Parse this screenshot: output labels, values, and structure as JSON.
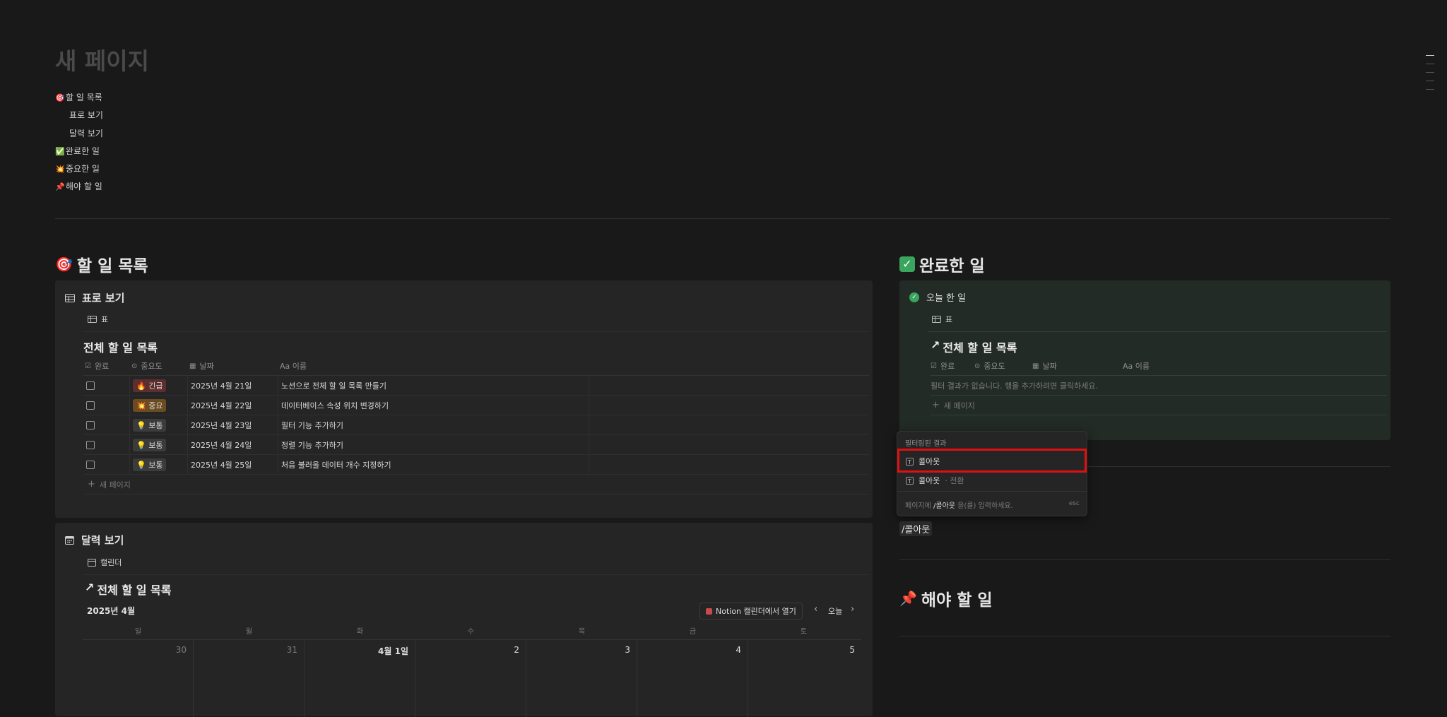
{
  "page": {
    "title": "새 페이지",
    "toc": [
      {
        "emoji": "🎯",
        "label": "할 일 목록"
      },
      {
        "emoji": "",
        "label": "표로 보기"
      },
      {
        "emoji": "",
        "label": "달력 보기"
      },
      {
        "emoji": "✅",
        "label": "완료한 일"
      },
      {
        "emoji": "💥",
        "label": "중요한 일"
      },
      {
        "emoji": "📌",
        "label": "해야 할 일"
      }
    ]
  },
  "todo": {
    "heading_emoji": "🎯",
    "heading": "할 일 목록",
    "table_view": {
      "title": "표로 보기",
      "tab_label": "표",
      "db_title": "전체 할 일 목록",
      "columns": [
        "완료",
        "중요도",
        "날짜",
        "Aa 이름"
      ],
      "rows": [
        {
          "priority": "🔥 긴급",
          "date": "2025년 4월 21일",
          "name": "노션으로 전체 할 일 목록 만들기",
          "tag_color": "#5e2e2e"
        },
        {
          "priority": "💥 중요",
          "date": "2025년 4월 22일",
          "name": "데이터베이스 속성 위치 변경하기",
          "tag_color": "#6b4b22"
        },
        {
          "priority": "💡 보통",
          "date": "2025년 4월 23일",
          "name": "필터 기능 추가하기",
          "tag_color": "#3b3b3b"
        },
        {
          "priority": "💡 보통",
          "date": "2025년 4월 24일",
          "name": "정렬 기능 추가하기",
          "tag_color": "#3b3b3b"
        },
        {
          "priority": "💡 보통",
          "date": "2025년 4월 25일",
          "name": "처음 불러올 데이터 개수 지정하기",
          "tag_color": "#3b3b3b"
        }
      ],
      "new_page": "새 페이지"
    },
    "calendar_view": {
      "title": "달력 보기",
      "tab_label": "캘린더",
      "db_title": "전체 할 일 목록",
      "month": "2025년 4월",
      "open_notion": "Notion 캘린더에서 열기",
      "today": "오늘",
      "weekdays": [
        "일",
        "월",
        "화",
        "수",
        "목",
        "금",
        "토"
      ],
      "days": [
        "30",
        "31",
        "4월 1일",
        "2",
        "3",
        "4",
        "5"
      ]
    }
  },
  "done": {
    "heading_emoji": "✅",
    "heading": "완료한 일",
    "view_title": "오늘 한 일",
    "tab_label": "표",
    "db_title": "전체 할 일 목록",
    "columns": [
      "완료",
      "중요도",
      "날짜",
      "Aa 이름"
    ],
    "empty": "필터 결과가 없습니다. 행을 추가하려면 클릭하세요.",
    "new_page": "새 페이지"
  },
  "menu": {
    "header": "필터링된 결과",
    "options": [
      {
        "label": "콜아웃",
        "sub": ""
      },
      {
        "label": "콜아웃",
        "sub": "· 전환"
      }
    ],
    "footer_pre": "페이지에",
    "footer_cmd": "/콜아웃",
    "footer_post": "을(를) 입력하세요.",
    "esc": "esc"
  },
  "slash_text": "/콜아웃",
  "must": {
    "heading_emoji": "📌",
    "heading": "해야 할 일"
  },
  "colors": {
    "bg": "#191919",
    "panel": "#252525",
    "highlight": "#e01010",
    "check_green": "#3aa55c"
  }
}
